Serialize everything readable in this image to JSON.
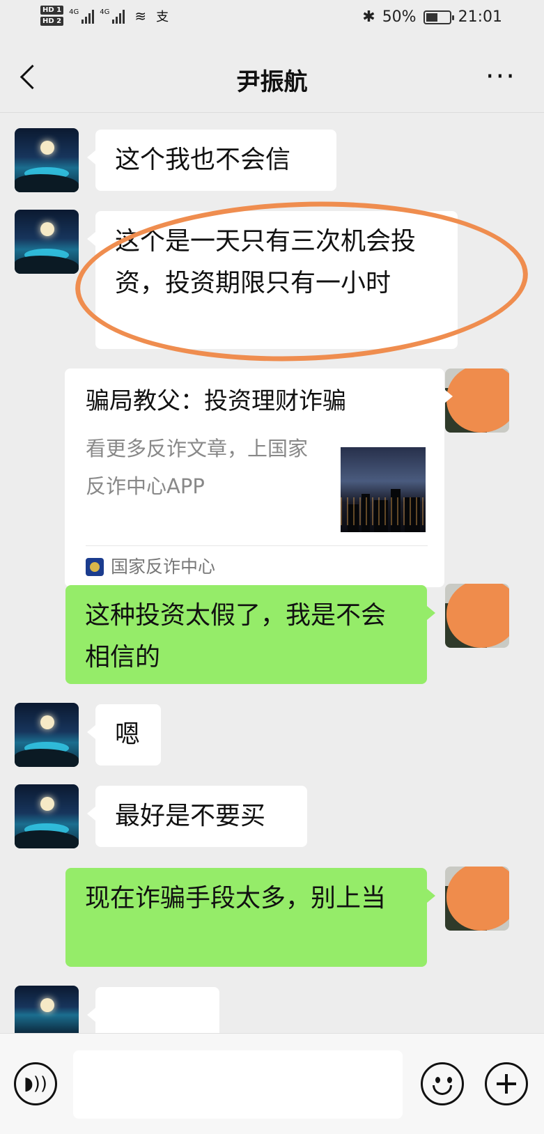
{
  "status_bar": {
    "hd_badges": [
      "HD 1",
      "HD 2"
    ],
    "network": [
      "4G",
      "4G"
    ],
    "battery_text": "50%",
    "battery_level": 0.5,
    "time": "21:01"
  },
  "header": {
    "title": "尹振航"
  },
  "messages": [
    {
      "side": "left",
      "text": "这个我也不会信"
    },
    {
      "side": "left",
      "text": "这个是一天只有三次机会投资，投资期限只有一小时"
    },
    {
      "side": "right",
      "type": "link",
      "title": "骗局教父：投资理财诈骗",
      "description": "看更多反诈文章，上国家反诈中心APP",
      "source": "国家反诈中心"
    },
    {
      "side": "right",
      "text": "这种投资太假了，我是不会相信的"
    },
    {
      "side": "left",
      "text": "嗯"
    },
    {
      "side": "left",
      "text": "最好是不要买"
    },
    {
      "side": "right",
      "text": "现在诈骗手段太多，别上当"
    }
  ],
  "colors": {
    "background": "#ededed",
    "outgoing_bubble": "#95ec69",
    "incoming_bubble": "#ffffff",
    "annotation_circle": "#ef8d4f"
  },
  "icons": {
    "back": "chevron-left-icon",
    "more": "more-horizontal-icon",
    "voice": "voice-icon",
    "emoji": "emoji-icon",
    "plus": "plus-icon"
  }
}
